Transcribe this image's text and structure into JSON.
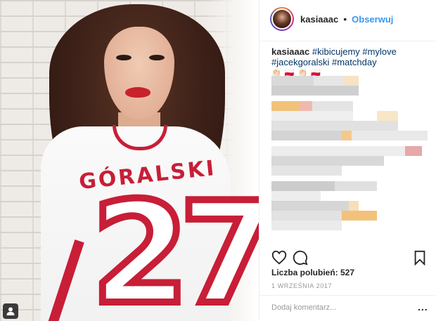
{
  "photo": {
    "jersey_name": "GÓRALSKI",
    "jersey_number": "27",
    "badge_icon": "user-tag-icon"
  },
  "header": {
    "username": "kasiaaac",
    "separator": "•",
    "follow_label": "Obserwuj"
  },
  "caption": {
    "username": "kasiaaac",
    "hashtags": [
      "#kibicujemy",
      "#mylove",
      "#jacekgoralski",
      "#matchday"
    ],
    "emojis": "👏🏻 🇵🇱 👏🏻 🇵🇱"
  },
  "actions": {
    "like_icon": "heart-icon",
    "comment_icon": "comment-icon",
    "save_icon": "bookmark-icon"
  },
  "likes": {
    "text": "Liczba polubień: 527"
  },
  "date": "1 WRZEŚNIA 2017",
  "comment_box": {
    "placeholder": "Dodaj komentarz...",
    "more_label": "..."
  },
  "colors": {
    "link_blue": "#3897f0",
    "hashtag_blue": "#003569",
    "jersey_red": "#c81e37"
  }
}
